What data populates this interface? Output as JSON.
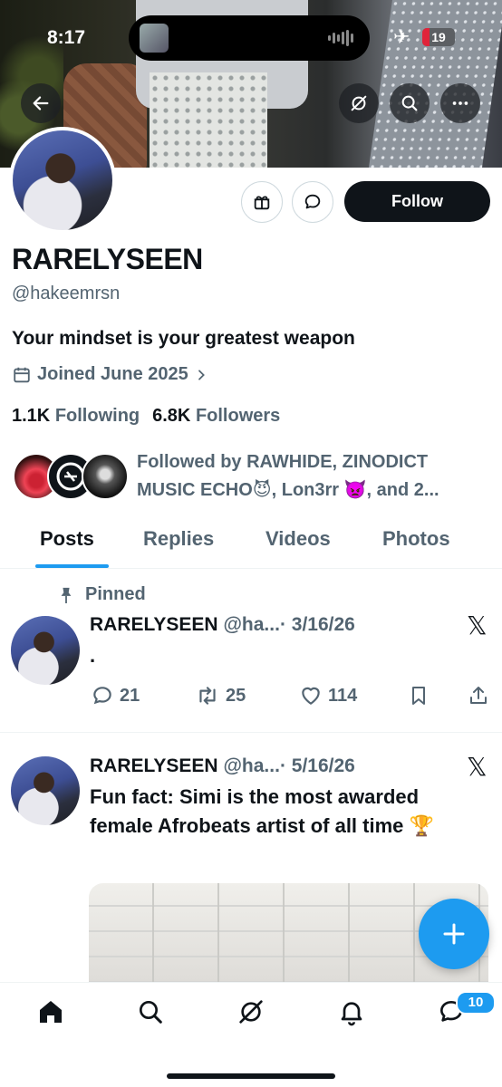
{
  "status_bar": {
    "time": "8:17",
    "battery": "19"
  },
  "profile": {
    "name": "RARELYSEEN",
    "handle": "@hakeemrsn",
    "bio": "Your mindset is your greatest weapon",
    "joined": "Joined June 2025",
    "following_count": "1.1K",
    "following_label": "Following",
    "followers_count": "6.8K",
    "followers_label": "Followers",
    "follow_button": "Follow",
    "followed_by_line1": "Followed by RAWHIDE, ZINODICT",
    "followed_by_line2": "MUSIC ECHO😈, Lon3rr 👿, and 2..."
  },
  "tabs": [
    {
      "label": "Posts",
      "active": true
    },
    {
      "label": "Replies",
      "active": false
    },
    {
      "label": "Videos",
      "active": false
    },
    {
      "label": "Photos",
      "active": false
    }
  ],
  "posts": [
    {
      "pinned_label": "Pinned",
      "author": "RARELYSEEN",
      "handle": "@ha...",
      "date": "· 3/16/26",
      "text": ".",
      "replies": "21",
      "reposts": "25",
      "likes": "114"
    },
    {
      "author": "RARELYSEEN",
      "handle": "@ha...",
      "date": "· 5/16/26",
      "text": "Fun fact: Simi is the most awarded female Afrobeats artist of all time 🏆"
    }
  ],
  "nav": {
    "messages_badge": "10"
  },
  "icons": [
    "back-arrow-icon",
    "grok-icon",
    "search-icon",
    "more-icon",
    "gift-icon",
    "message-icon",
    "calendar-icon",
    "chevron-right-icon",
    "pin-icon",
    "x-logo-icon",
    "reply-icon",
    "repost-icon",
    "like-icon",
    "bookmark-icon",
    "share-icon",
    "plus-icon",
    "home-icon",
    "bell-icon",
    "chat-icon"
  ],
  "colors": {
    "accent": "#1d9bf0",
    "text": "#0f1419",
    "secondary": "#536471"
  }
}
